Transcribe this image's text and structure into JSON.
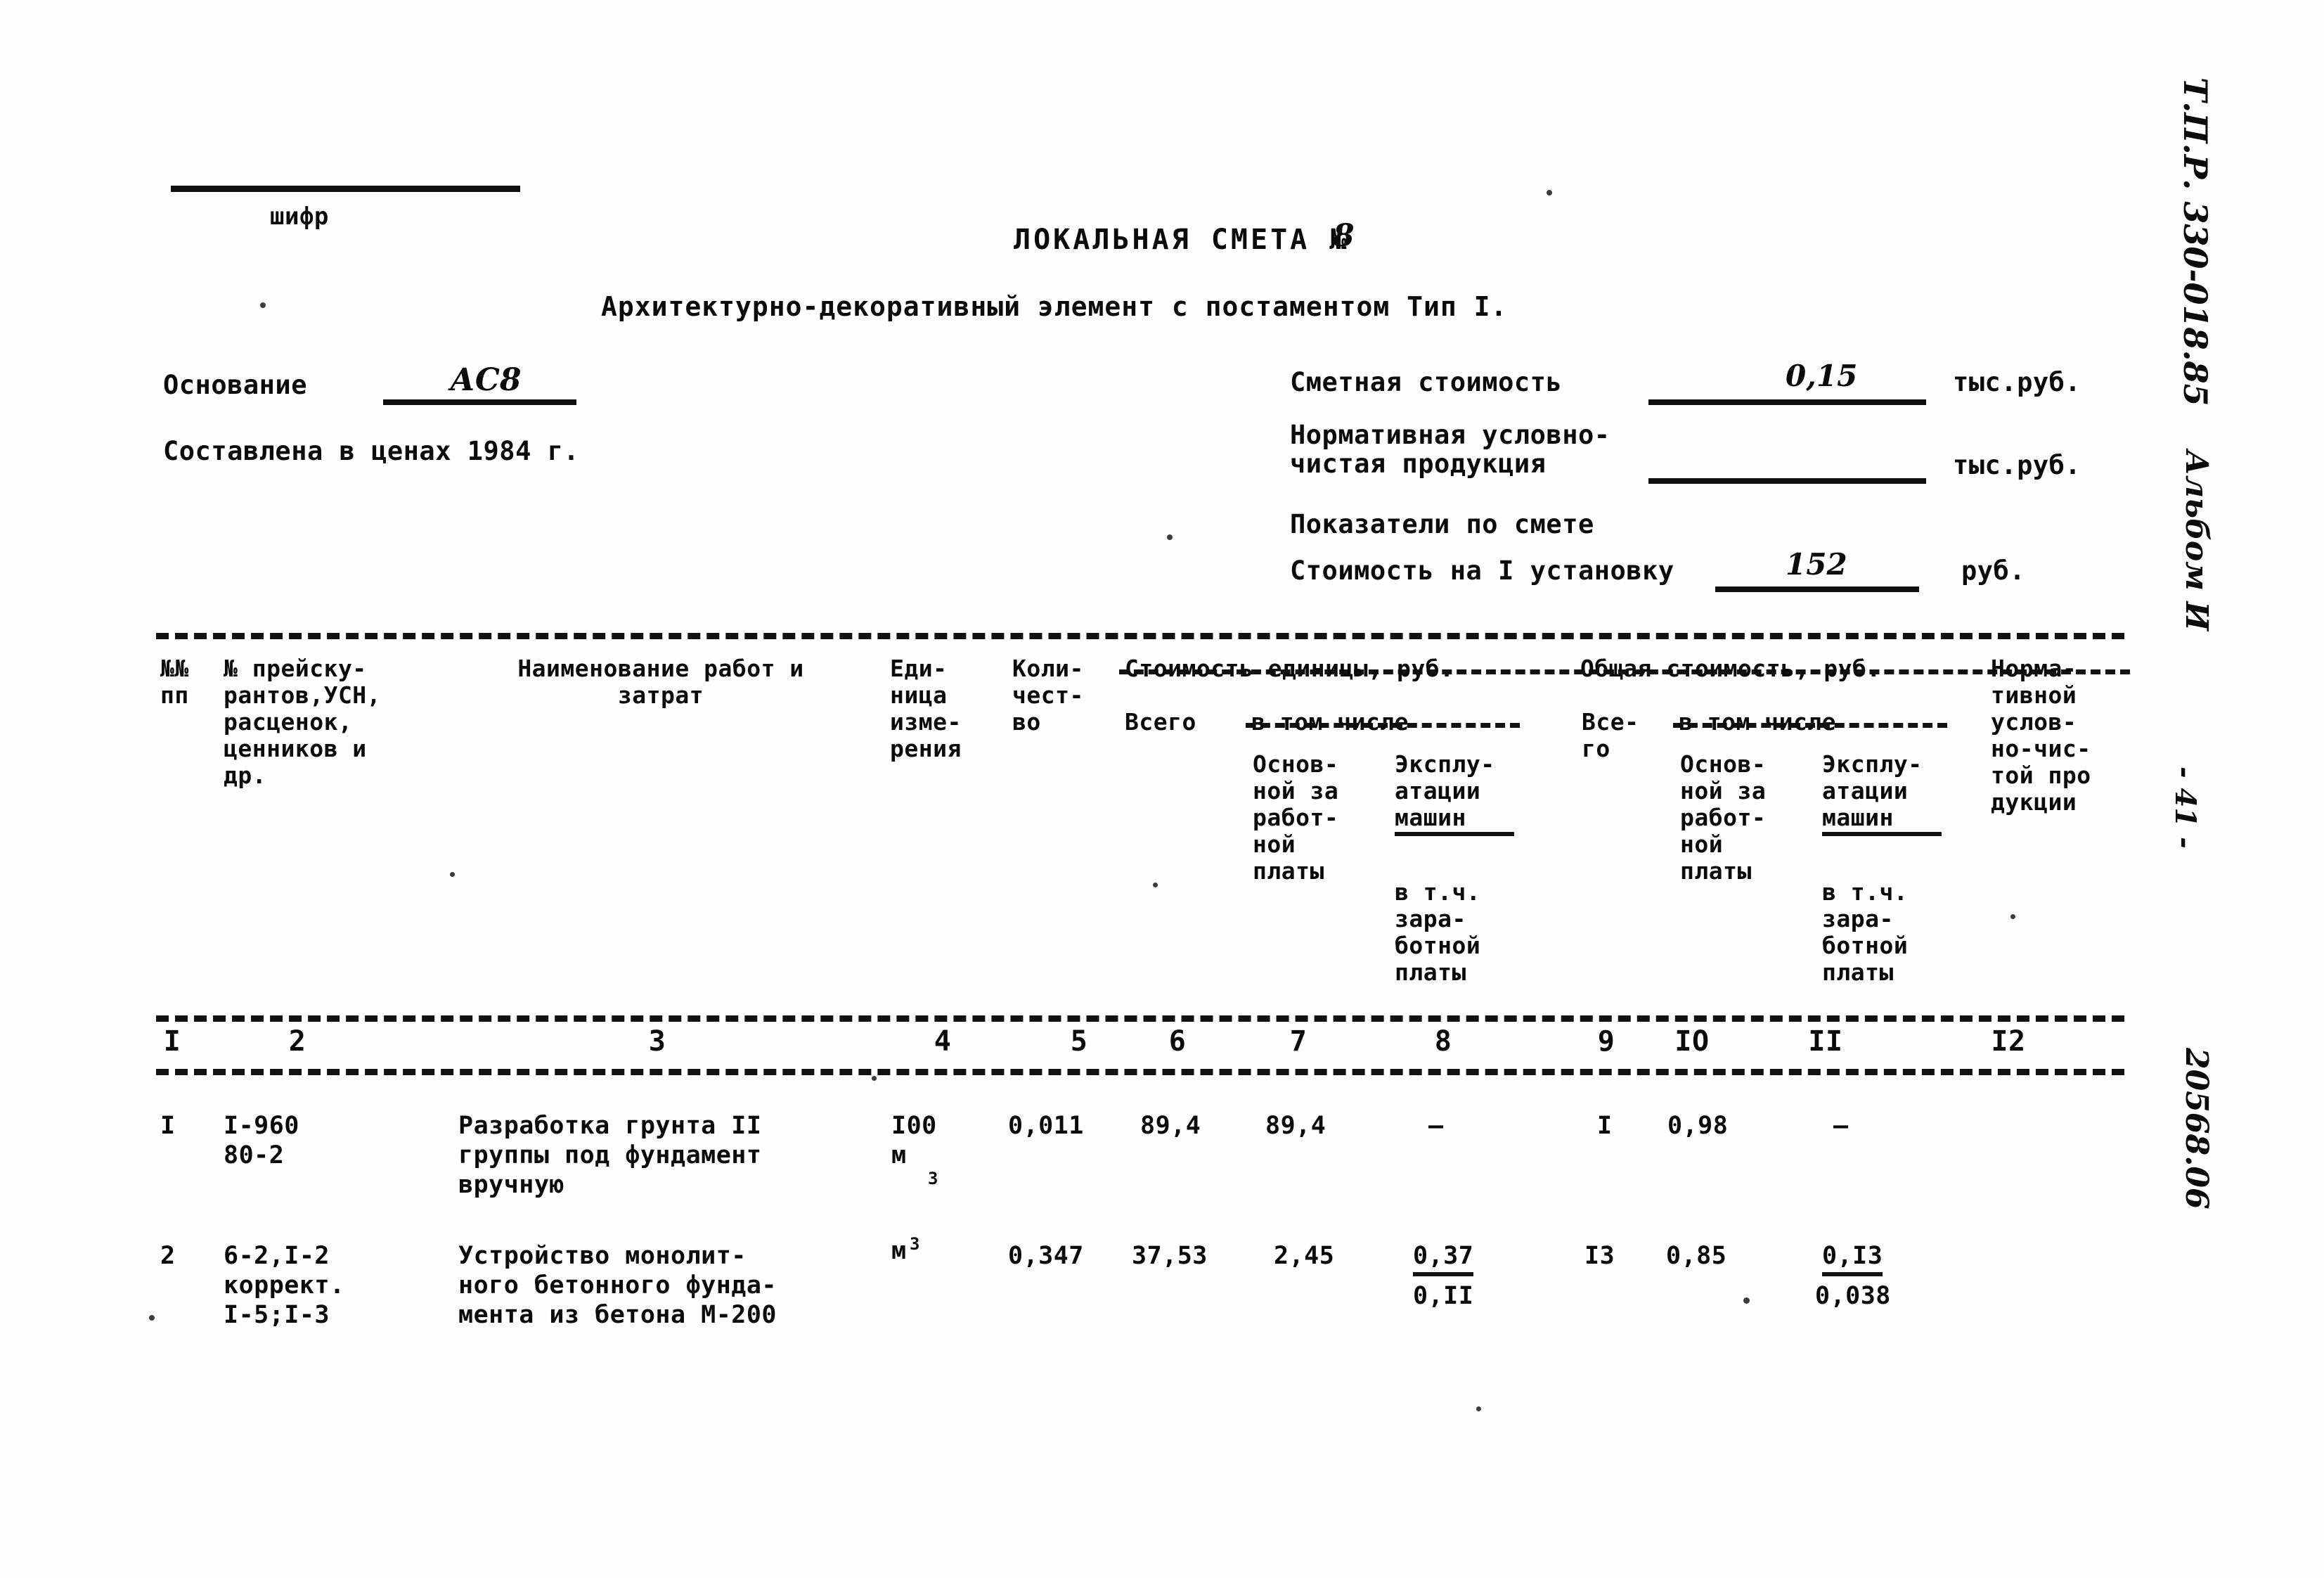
{
  "header": {
    "cipher_label": "шифр",
    "title": "ЛОКАЛЬНАЯ СМЕТА №",
    "number": "8",
    "subtitle": "Архитектурно-декоративный элемент с постаментом  Тип I.",
    "basis_label": "Основание",
    "basis_value": "АС8",
    "prices_line": "Составлена в ценах 1984 г.",
    "estimate_cost_label": "Сметная стоимость",
    "estimate_cost_value": "0,15",
    "estimate_cost_unit": "тыс.руб.",
    "net_product_label": "Нормативная условно-\nчистая продукция",
    "net_product_value": "",
    "net_product_unit": "тыс.руб.",
    "indicators_label": "Показатели по смете",
    "unit_cost_label": "Стоимость на I установку",
    "unit_cost_value": "152",
    "unit_cost_unit": "руб."
  },
  "table": {
    "group_headers": {
      "unit_cost_group": "Стоимость единицы, руб.",
      "total_cost_group": "Общая стоимость, руб.",
      "including_1": "в том числе",
      "including_2": "в том числе"
    },
    "columns": [
      {
        "num": "I",
        "label": "№№\nпп"
      },
      {
        "num": "2",
        "label": "№ прейску-\nрантов,УСН,\nрасценок,\nценников и\nдр."
      },
      {
        "num": "3",
        "label": "Наименование работ и\nзатрат"
      },
      {
        "num": "4",
        "label": "Еди-\nница\nизме-\nрения"
      },
      {
        "num": "5",
        "label": "Коли-\nчест-\nво"
      },
      {
        "num": "6",
        "label": "Всего"
      },
      {
        "num": "7",
        "label": "Основ-\nной за\nработ-\nной\nплаты"
      },
      {
        "num": "8",
        "label": "Эксплу-\nатации\nмашин",
        "sub": "в т.ч.\nзара-\nботной\nплаты"
      },
      {
        "num": "9",
        "label": "Все-\nго"
      },
      {
        "num": "IO",
        "label": "Основ-\nной за\nработ-\nной\nплаты"
      },
      {
        "num": "II",
        "label": "Эксплу-\nатации\nмашин",
        "sub": "в т.ч.\nзара-\nботной\nплаты"
      },
      {
        "num": "I2",
        "label": "Норма-\nтивной\nуслов-\nно-чис-\nтой про\nдукции"
      }
    ],
    "rows": [
      {
        "no": "I",
        "code": "I-960\n80-2",
        "description": "Разработка грунта II\nгруппы под фундамент\nвручную",
        "unit": "I00\nм",
        "unit_sup": "3",
        "qty": "0,011",
        "unit_total": "89,4",
        "unit_wage": "89,4",
        "unit_machine": "–",
        "unit_machine_sub": "",
        "total": "I",
        "total_wage": "0,98",
        "total_machine": "–",
        "total_machine_sub": "",
        "ncp": ""
      },
      {
        "no": "2",
        "code": "6-2,I-2\nкоррект.\nI-5;I-3",
        "description": "Устройство монолит-\nного бетонного фунда-\nмента из бетона М-200",
        "unit": "м",
        "unit_sup": "3",
        "qty": "0,347",
        "unit_total": "37,53",
        "unit_wage": "2,45",
        "unit_machine": "0,37",
        "unit_machine_sub": "0,II",
        "total": "I3",
        "total_wage": "0,85",
        "total_machine": "0,I3",
        "total_machine_sub": "0,038",
        "ncp": ""
      }
    ]
  },
  "margin": {
    "code": "Т.П.Р. 330-018.85",
    "album": "Альбом И",
    "page": "- 41 -",
    "stamp": "20568.06"
  }
}
